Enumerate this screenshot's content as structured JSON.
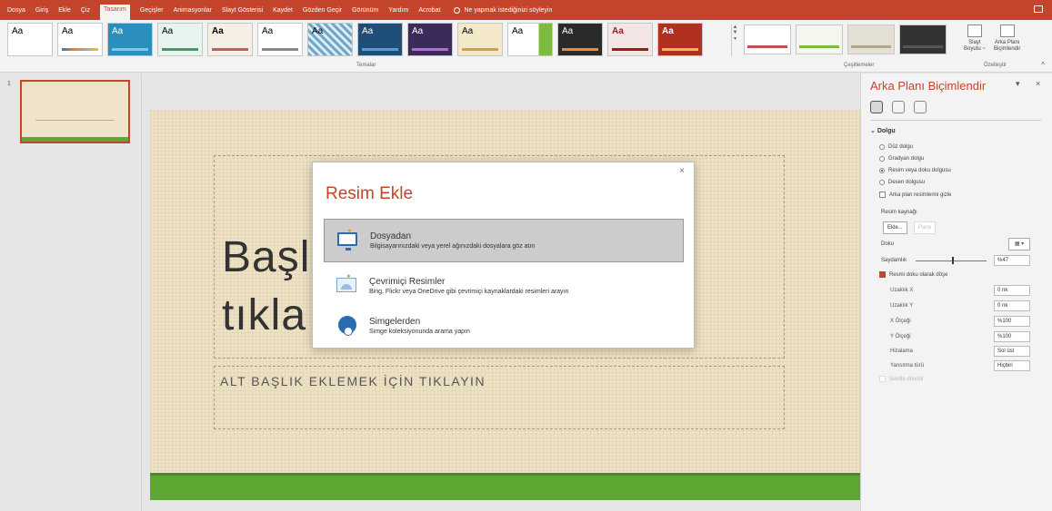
{
  "menu": {
    "items": [
      "Dosya",
      "Giriş",
      "Ekle",
      "Çiz",
      "Tasarım",
      "Geçişler",
      "Animasyonlar",
      "Slayt Gösterisi",
      "Kaydet",
      "Gözden Geçir",
      "Görünüm",
      "Yardım",
      "Acrobat"
    ],
    "active_index": 4,
    "tell_me": "Ne yapmak istediğinizi söyleyin"
  },
  "ribbon": {
    "themes_label": "Temalar",
    "variants_label": "Çeşitlemeler",
    "customize_label": "Özelleştir",
    "slide_size_label_1": "Slayt",
    "slide_size_label_2": "Boyutu ~",
    "format_bg_label_1": "Arka Planı",
    "format_bg_label_2": "Biçimlendir",
    "theme_sample_text": "Aa"
  },
  "slide_pane": {
    "slide_number": "1"
  },
  "slide": {
    "title_partial_1": "Başl",
    "title_partial_2": "tıkla",
    "subtitle": "ALT BAŞLIK EKLEMEK İÇİN TIKLAYIN"
  },
  "dialog": {
    "title": "Resim Ekle",
    "close": "×",
    "options": [
      {
        "label": "Dosyadan",
        "description": "Bilgisayarınızdaki veya yerel ağınızdaki dosyalara göz atın"
      },
      {
        "label": "Çevrimiçi Resimler",
        "description": "Bing, Flickr veya OneDrive gibi çevrimiçi kaynaklardaki resimleri arayın"
      },
      {
        "label": "Simgelerden",
        "description": "Simge koleksiyonunda arama yapın"
      }
    ]
  },
  "format_pane": {
    "title": "Arka Planı Biçimlendir",
    "section": "Dolgu",
    "fill_options": [
      "Düz dolgu",
      "Gradyan dolgu",
      "Resim veya doku dolgusu",
      "Desen dolgusu"
    ],
    "hide_bg_graphics": "Arka plan resimlerini gizle",
    "picture_source": "Resim kaynağı",
    "insert_btn": "Ekle...",
    "paste_btn": "Pano",
    "texture_label": "Doku",
    "transparency_label": "Saydamlık",
    "transparency_value": "%47",
    "tile_label": "Resmi doku olarak döşe",
    "offset_x_label": "Uzaklık X",
    "offset_x_value": "0 nk",
    "offset_y_label": "Uzaklık Y",
    "offset_y_value": "0 nk",
    "scale_x_label": "X Ölçeği",
    "scale_x_value": "%100",
    "scale_y_label": "Y Ölçeği",
    "scale_y_value": "%100",
    "alignment_label": "Hizalama",
    "alignment_value": "Sol üst",
    "mirror_label": "Yansıtma türü",
    "mirror_value": "Hiçbiri",
    "rotate_label": "Şekille döndür"
  }
}
